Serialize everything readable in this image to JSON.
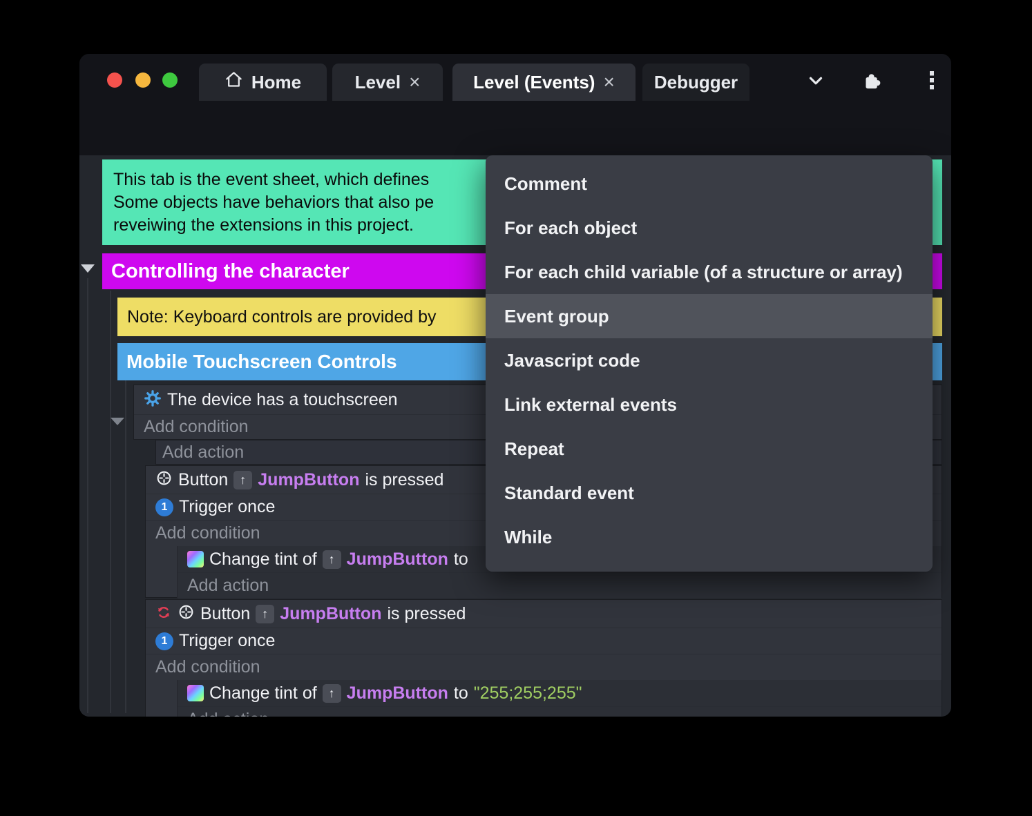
{
  "colors": {
    "accent_purple_button": "#6150cc",
    "comment_block": "#55e6b5",
    "group_header_magenta": "#ce08ef",
    "note_yellow": "#eedd65",
    "group_header_blue": "#4fa6e6",
    "object_name_purple": "#c77ef0",
    "string_value_green": "#a0ce62",
    "trigger_once_blue": "#2e7cd6"
  },
  "titlebar": {
    "tabs": {
      "home": "Home",
      "level": "Level",
      "level_events": "Level (Events)",
      "debugger": "Debugger"
    },
    "close_glyph": "×"
  },
  "sheet": {
    "comment_line1": "This tab is the event sheet, which defines",
    "comment_line2": "Some objects have behaviors that also pe",
    "comment_line3": "reveiwing the extensions in this project.",
    "group_character": "Controlling the character",
    "note": "Note: Keyboard controls are provided by",
    "group_touch": "Mobile Touchscreen Controls",
    "touch_condition": "The device has a touchscreen",
    "add_condition": "Add condition",
    "add_action": "Add action",
    "button_word": "Button",
    "object_name": "JumpButton",
    "is_pressed": "is pressed",
    "trigger_once": "Trigger once",
    "trigger_badge": "1",
    "change_tint_of": "Change tint of",
    "to_word": "to",
    "tint_value": "\"255;255;255\""
  },
  "menu": {
    "items": [
      "Comment",
      "For each object",
      "For each child variable (of a structure or array)",
      "Event group",
      "Javascript code",
      "Link external events",
      "Repeat",
      "Standard event",
      "While"
    ],
    "highlighted_item": "Event group"
  }
}
